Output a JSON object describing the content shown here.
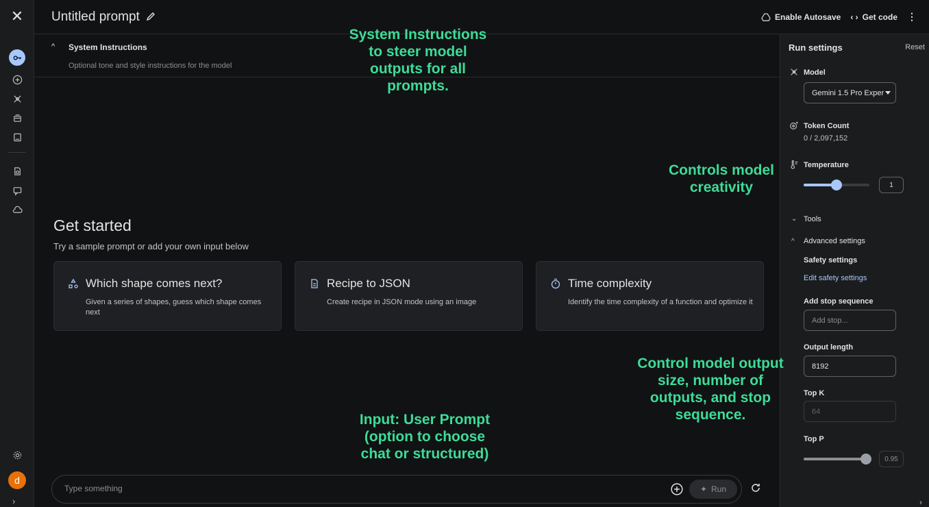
{
  "header": {
    "title": "Untitled prompt",
    "autosave_label": "Enable Autosave",
    "get_code_label": "Get code"
  },
  "system_instructions": {
    "title": "System Instructions",
    "placeholder": "Optional tone and style instructions for the model"
  },
  "get_started": {
    "title": "Get started",
    "subtitle": "Try a sample prompt or add your own input below",
    "cards": [
      {
        "icon": "shapes-icon",
        "title": "Which shape comes next?",
        "desc": "Given a series of shapes, guess which shape comes next"
      },
      {
        "icon": "document-icon",
        "title": "Recipe to JSON",
        "desc": "Create recipe in JSON mode using an image"
      },
      {
        "icon": "timer-icon",
        "title": "Time complexity",
        "desc": "Identify the time complexity of a function and optimize it"
      }
    ]
  },
  "input": {
    "placeholder": "Type something",
    "run_label": "Run"
  },
  "user": {
    "avatar_letter": "d"
  },
  "run_settings": {
    "title": "Run settings",
    "reset_label": "Reset",
    "model_label": "Model",
    "model_value": "Gemini 1.5 Pro Exper",
    "token_label": "Token Count",
    "token_value": "0 / 2,097,152",
    "temperature_label": "Temperature",
    "temperature_value": "1",
    "tools_label": "Tools",
    "advanced_label": "Advanced settings",
    "safety_label": "Safety settings",
    "safety_link": "Edit safety settings",
    "stop_label": "Add stop sequence",
    "stop_placeholder": "Add stop...",
    "output_label": "Output length",
    "output_value": "8192",
    "topk_label": "Top K",
    "topk_value": "64",
    "topp_label": "Top P",
    "topp_value": "0.95"
  },
  "annotations": {
    "system": "System Instructions\nto steer model\noutputs for all\nprompts.",
    "temperature": "Controls model\ncreativity",
    "output": "Control model output\nsize, number of\noutputs, and stop\nsequence.",
    "input": "Input: User Prompt\n(option to choose\nchat or structured)"
  },
  "colors": {
    "accent": "#a8c7fa",
    "annotation": "#3ddc97",
    "avatar": "#e8710a"
  }
}
